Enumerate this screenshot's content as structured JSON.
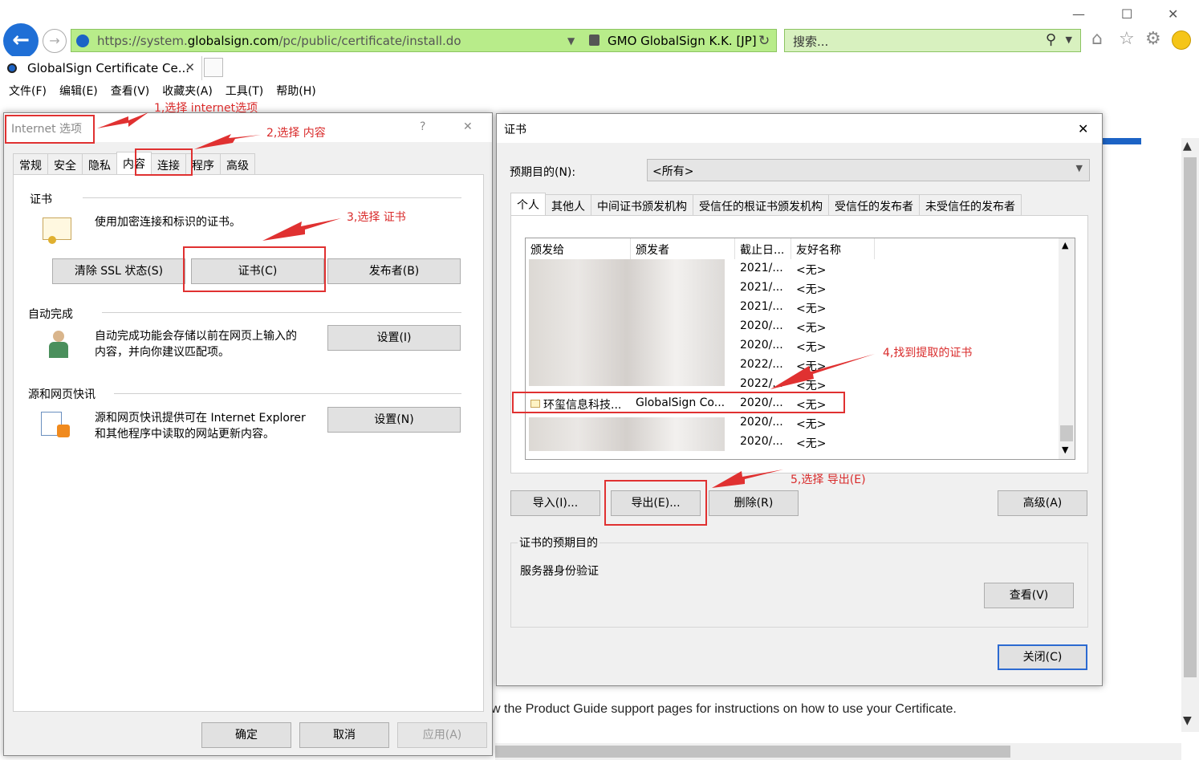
{
  "browser": {
    "url_prefix": "https://system.",
    "url_domain": "globalsign.com",
    "url_path": "/pc/public/certificate/install.do",
    "cert_org": "GMO GlobalSign K.K. [JP]",
    "search_placeholder": "搜索...",
    "tab_title": "GlobalSign Certificate Ce...",
    "menu": [
      "文件(F)",
      "编辑(E)",
      "查看(V)",
      "收藏夹(A)",
      "工具(T)",
      "帮助(H)"
    ],
    "page_text": "w the Product Guide support pages for instructions on how to use your Certificate."
  },
  "internet_options": {
    "title": "Internet 选项",
    "help": "?",
    "close": "✕",
    "tabs": [
      "常规",
      "安全",
      "隐私",
      "内容",
      "连接",
      "程序",
      "高级"
    ],
    "active_tab": "内容",
    "cert_section": "证书",
    "cert_desc": "使用加密连接和标识的证书。",
    "btn_clear_ssl": "清除 SSL 状态(S)",
    "btn_certificates": "证书(C)",
    "btn_publishers": "发布者(B)",
    "autocomplete_section": "自动完成",
    "autocomplete_desc_1": "自动完成功能会存储以前在网页上输入的",
    "autocomplete_desc_2": "内容，并向你建议匹配项。",
    "btn_autocomplete_settings": "设置(I)",
    "feeds_section": "源和网页快讯",
    "feeds_desc_1": "源和网页快讯提供可在 Internet Explorer",
    "feeds_desc_2": "和其他程序中读取的网站更新内容。",
    "btn_feeds_settings": "设置(N)",
    "btn_ok": "确定",
    "btn_cancel": "取消",
    "btn_apply": "应用(A)"
  },
  "certificates": {
    "title": "证书",
    "close": "✕",
    "purpose_label": "预期目的(N):",
    "purpose_value": "<所有>",
    "tabs": [
      "个人",
      "其他人",
      "中间证书颁发机构",
      "受信任的根证书颁发机构",
      "受信任的发布者",
      "未受信任的发布者"
    ],
    "active_tab": "个人",
    "columns": [
      "颁发给",
      "颁发者",
      "截止日...",
      "友好名称"
    ],
    "rows": [
      {
        "issued_to": "",
        "issued_by": "",
        "expires": "2021/...",
        "friendly": "<无>"
      },
      {
        "issued_to": "",
        "issued_by": "",
        "expires": "2021/...",
        "friendly": "<无>"
      },
      {
        "issued_to": "",
        "issued_by": "",
        "expires": "2021/...",
        "friendly": "<无>"
      },
      {
        "issued_to": "",
        "issued_by": "",
        "expires": "2020/...",
        "friendly": "<无>"
      },
      {
        "issued_to": "",
        "issued_by": "",
        "expires": "2020/...",
        "friendly": "<无>"
      },
      {
        "issued_to": "",
        "issued_by": "",
        "expires": "2022/...",
        "friendly": "<无>"
      },
      {
        "issued_to": "",
        "issued_by": "",
        "expires": "2022/...",
        "friendly": "<无>"
      },
      {
        "issued_to": "环玺信息科技...",
        "issued_by": "GlobalSign Co...",
        "expires": "2020/...",
        "friendly": "<无>"
      },
      {
        "issued_to": "",
        "issued_by": "",
        "expires": "2020/...",
        "friendly": "<无>"
      },
      {
        "issued_to": "",
        "issued_by": "",
        "expires": "2020/...",
        "friendly": "<无>"
      }
    ],
    "btn_import": "导入(I)...",
    "btn_export": "导出(E)...",
    "btn_remove": "删除(R)",
    "btn_advanced": "高级(A)",
    "purposes_section": "证书的预期目的",
    "purposes_value": "服务器身份验证",
    "btn_view": "查看(V)",
    "btn_close": "关闭(C)"
  },
  "annotations": {
    "step1": "1,选择 internet选项",
    "step2": "2,选择 内容",
    "step3": "3,选择 证书",
    "step4": "4,找到提取的证书",
    "step5": "5,选择 导出(E)"
  },
  "colors": {
    "annotation_red": "#e03131",
    "address_green": "#b8ec8a",
    "accent_blue": "#1c63c5"
  }
}
